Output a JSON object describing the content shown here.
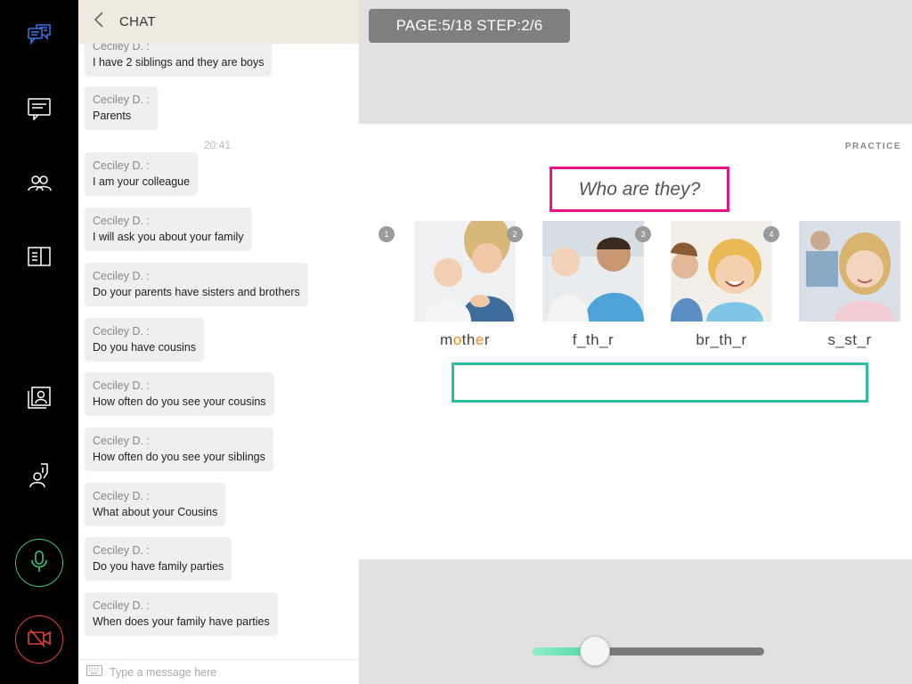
{
  "chat": {
    "title": "CHAT",
    "timestamp": "20:41",
    "input_placeholder": "Type a message here",
    "messages": [
      {
        "author": "Ceciley D. :",
        "text": "I have 2 siblings and they are boys"
      },
      {
        "author": "Ceciley D. :",
        "text": "Parents"
      },
      {
        "author": "Ceciley D. :",
        "text": "I am your colleague"
      },
      {
        "author": "Ceciley D. :",
        "text": "I will ask you about your family"
      },
      {
        "author": "Ceciley D. :",
        "text": "Do your parents have sisters and brothers"
      },
      {
        "author": "Ceciley D. :",
        "text": "Do you have cousins"
      },
      {
        "author": "Ceciley D. :",
        "text": "How often do you see your cousins"
      },
      {
        "author": "Ceciley D. :",
        "text": "How often do you see your siblings"
      },
      {
        "author": "Ceciley D. :",
        "text": "What about your Cousins"
      },
      {
        "author": "Ceciley D. :",
        "text": "Do you have family parties"
      },
      {
        "author": "Ceciley D. :",
        "text": "When does your family have parties"
      }
    ]
  },
  "badge": {
    "text": "PAGE:5/18 STEP:2/6"
  },
  "slide": {
    "practice_label": "PRACTICE",
    "title": "Who are they?",
    "cards": [
      {
        "num": "1",
        "word_parts": [
          "m",
          "o",
          "th",
          "e",
          "r"
        ]
      },
      {
        "num": "2",
        "word": "f_th_r"
      },
      {
        "num": "3",
        "word": "br_th_r"
      },
      {
        "num": "4",
        "word": "s_st_r"
      }
    ],
    "answer": ""
  },
  "slider": {
    "progress": 0.27
  },
  "colors": {
    "mic": "#3fc37a",
    "camera": "#e0403a",
    "title_border": "#e6168a",
    "answer_border": "#2bbfa0",
    "highlight": "#f08a24",
    "chat_icon_active": "#3d6fe0"
  },
  "icons": [
    "chat-icon",
    "notes-icon",
    "participants-icon",
    "book-icon",
    "contact-card-icon",
    "raise-hand-icon",
    "microphone-icon",
    "camera-off-icon",
    "keyboard-icon",
    "back-icon"
  ]
}
